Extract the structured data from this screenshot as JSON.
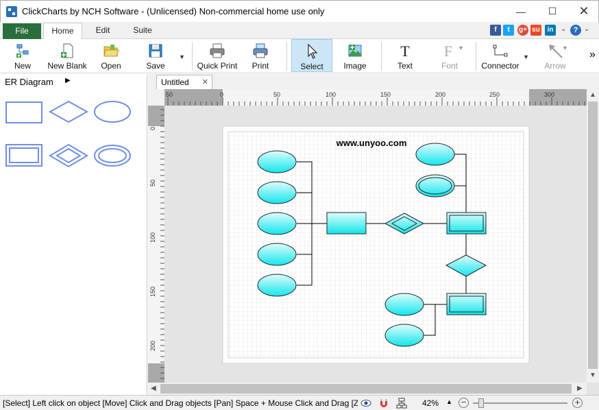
{
  "window": {
    "title": "ClickCharts by NCH Software - (Unlicensed) Non-commercial home use only",
    "minimize": "—",
    "maximize": "☐",
    "close": "✕"
  },
  "menu": {
    "tabs": [
      {
        "label": "File"
      },
      {
        "label": "Home"
      },
      {
        "label": "Edit"
      },
      {
        "label": "Suite"
      }
    ],
    "social": [
      "f",
      "t",
      "g+",
      "su",
      "in"
    ],
    "help": "?"
  },
  "toolbar": {
    "buttons": [
      {
        "label": "New",
        "icon": "new-flowchart-icon"
      },
      {
        "label": "New Blank",
        "icon": "new-blank-icon"
      },
      {
        "label": "Open",
        "icon": "folder-icon"
      },
      {
        "label": "Save",
        "icon": "save-icon"
      },
      {
        "label": "Quick Print",
        "icon": "quick-print-icon"
      },
      {
        "label": "Print",
        "icon": "print-icon"
      },
      {
        "label": "Select",
        "icon": "cursor-icon"
      },
      {
        "label": "Image",
        "icon": "image-icon"
      },
      {
        "label": "Text",
        "icon": "text-icon"
      },
      {
        "label": "Font",
        "icon": "font-icon"
      },
      {
        "label": "Connector",
        "icon": "connector-icon"
      },
      {
        "label": "Arrow",
        "icon": "arrow-icon"
      }
    ],
    "more": "»"
  },
  "library": {
    "title": "ER Diagram",
    "arrow": "▶"
  },
  "document": {
    "tab_label": "Untitled",
    "tab_close": "✕",
    "watermark": "www.unyoo.com"
  },
  "rulers": {
    "h_ticks": [
      "50",
      "0",
      "50",
      "100",
      "150",
      "200",
      "250",
      "300"
    ],
    "v_ticks": [
      "0",
      "50",
      "100",
      "150",
      "200"
    ]
  },
  "status": {
    "text": "[Select] Left click on object  [Move] Click and Drag objects  [Pan] Space + Mouse Click and Drag  [Zoom]",
    "zoom": "42%",
    "zoom_minus": "−",
    "zoom_plus": "+"
  }
}
